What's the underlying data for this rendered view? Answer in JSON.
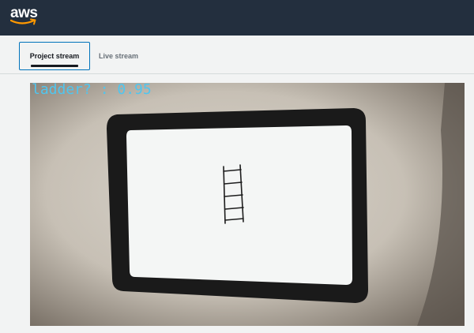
{
  "header": {
    "logo_text": "aws"
  },
  "tabs": [
    {
      "label": "Project stream",
      "active": true
    },
    {
      "label": "Live stream",
      "active": false
    }
  ],
  "stream": {
    "detection_label": "ladder? : 0.95",
    "label_color": "#4fc6f0"
  },
  "colors": {
    "topbar": "#232f3e",
    "accent": "#ff9900",
    "tab_border": "#0073bb"
  }
}
